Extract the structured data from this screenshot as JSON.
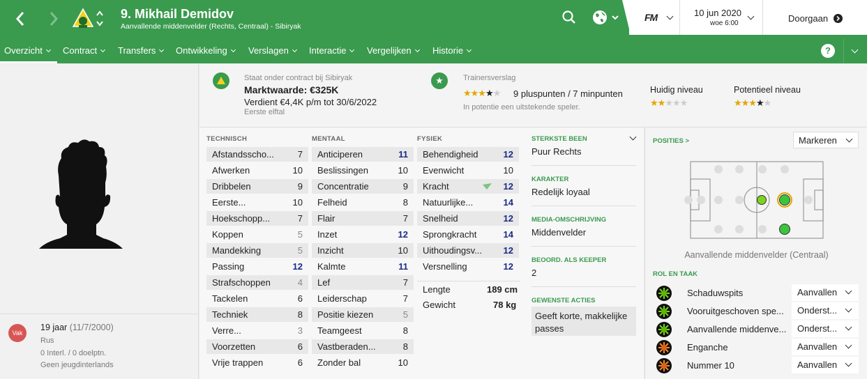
{
  "header": {
    "player_title": "9. Mikhail Demidov",
    "player_subtitle": "Aanvallende middenvelder (Rechts, Centraal) - Sibiryak",
    "fm_logo": "FM",
    "date": "10 jun 2020",
    "time": "woe 6:00",
    "continue_label": "Doorgaan",
    "icons": {
      "back": "chevron-left-icon",
      "forward": "chevron-right-icon",
      "search": "search-icon",
      "globe": "globe-icon"
    }
  },
  "menu": {
    "items": [
      "Overzicht",
      "Contract",
      "Transfers",
      "Ontwikkeling",
      "Verslagen",
      "Interactie",
      "Vergelijken",
      "Historie"
    ],
    "active": "Overzicht",
    "help": "?"
  },
  "player_info": {
    "badge": "Vak",
    "age": "19 jaar",
    "dob": "(11/7/2000)",
    "nationality": "Rus",
    "caps": "0 Interl. / 0 doelptn.",
    "youth": "Geen jeugdinterlands"
  },
  "contract": {
    "status": "Staat onder contract bij Sibiryak",
    "value": "Marktwaarde: €325K",
    "wage": "Verdient €4,4K p/m tot 30/6/2022",
    "squad": "Eerste elftal"
  },
  "scout": {
    "title": "Trainersverslag",
    "rating_stars": 3.5,
    "points": "9 pluspunten / 7 minpunten",
    "summary": "In potentie een uitstekende speler.",
    "current_label": "Huidig niveau",
    "current_stars": 2,
    "potential_label": "Potentieel niveau",
    "potential_stars": 3.5
  },
  "attributes": {
    "technical": {
      "header": "TECHNISCH",
      "rows": [
        {
          "name": "Afstandsscho...",
          "value": "7"
        },
        {
          "name": "Afwerken",
          "value": "10"
        },
        {
          "name": "Dribbelen",
          "value": "9"
        },
        {
          "name": "Eerste...",
          "value": "10"
        },
        {
          "name": "Hoekschopp...",
          "value": "7"
        },
        {
          "name": "Koppen",
          "value": "5"
        },
        {
          "name": "Mandekking",
          "value": "5"
        },
        {
          "name": "Passing",
          "value": "12"
        },
        {
          "name": "Strafschoppen",
          "value": "4"
        },
        {
          "name": "Tackelen",
          "value": "6"
        },
        {
          "name": "Techniek",
          "value": "8"
        },
        {
          "name": "Verre...",
          "value": "3"
        },
        {
          "name": "Voorzetten",
          "value": "6"
        },
        {
          "name": "Vrije trappen",
          "value": "6"
        }
      ]
    },
    "mental": {
      "header": "MENTAAL",
      "rows": [
        {
          "name": "Anticiperen",
          "value": "11"
        },
        {
          "name": "Beslissingen",
          "value": "10"
        },
        {
          "name": "Concentratie",
          "value": "9"
        },
        {
          "name": "Felheid",
          "value": "8"
        },
        {
          "name": "Flair",
          "value": "7"
        },
        {
          "name": "Inzet",
          "value": "12"
        },
        {
          "name": "Inzicht",
          "value": "10"
        },
        {
          "name": "Kalmte",
          "value": "11"
        },
        {
          "name": "Lef",
          "value": "7"
        },
        {
          "name": "Leiderschap",
          "value": "7"
        },
        {
          "name": "Positie kiezen",
          "value": "5"
        },
        {
          "name": "Teamgeest",
          "value": "8"
        },
        {
          "name": "Vastberaden...",
          "value": "8"
        },
        {
          "name": "Zonder bal",
          "value": "10"
        }
      ]
    },
    "physical": {
      "header": "FYSIEK",
      "rows": [
        {
          "name": "Behendigheid",
          "value": "12"
        },
        {
          "name": "Evenwicht",
          "value": "10"
        },
        {
          "name": "Kracht",
          "value": "12"
        },
        {
          "name": "Natuurlijke...",
          "value": "14"
        },
        {
          "name": "Snelheid",
          "value": "12"
        },
        {
          "name": "Sprongkracht",
          "value": "14"
        },
        {
          "name": "Uithoudingsv...",
          "value": "12"
        },
        {
          "name": "Versnelling",
          "value": "12"
        }
      ],
      "height_label": "Lengte",
      "height": "189 cm",
      "weight_label": "Gewicht",
      "weight": "78 kg"
    }
  },
  "details": {
    "foot_label": "STERKSTE BEEN",
    "foot": "Puur Rechts",
    "character_label": "KARAKTER",
    "character": "Redelijk loyaal",
    "media_label": "MEDIA-OMSCHRIJVING",
    "media": "Middenvelder",
    "keeper_label": "BEOORD. ALS KEEPER",
    "keeper": "2",
    "actions_label": "GEWENSTE ACTIES",
    "actions": "Geeft korte, makkelijke passes"
  },
  "positions": {
    "title": "POSITIES >",
    "highlight_label": "Markeren",
    "caption": "Aanvallende middenvelder (Centraal)",
    "roles_title": "ROL EN TAAK",
    "roles": [
      {
        "name": "Schaduwspits",
        "duty": "Aanvallen"
      },
      {
        "name": "Vooruitgeschoven spe...",
        "duty": "Onderst..."
      },
      {
        "name": "Aanvallende middenve...",
        "duty": "Onderst..."
      },
      {
        "name": "Enganche",
        "duty": "Aanvallen"
      },
      {
        "name": "Nummer 10",
        "duty": "Aanvallen"
      }
    ]
  },
  "colors": {
    "brand_green": "#3a9a4e",
    "high_value": "#1a2a8a",
    "star": "#e2a600"
  }
}
